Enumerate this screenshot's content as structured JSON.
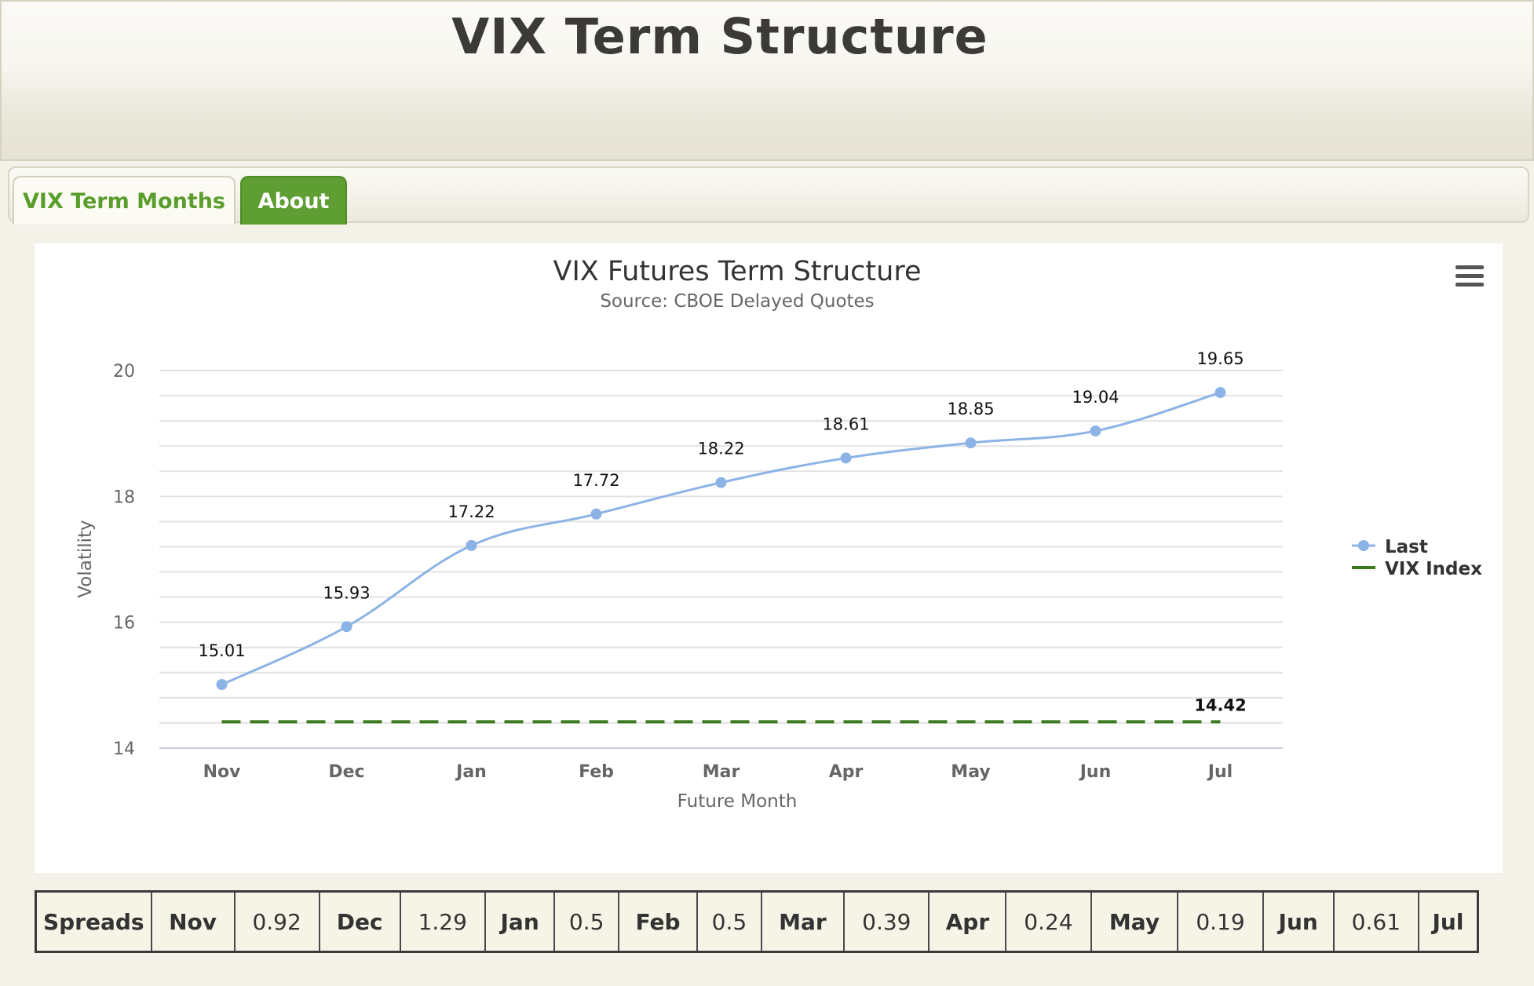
{
  "header": {
    "title": "VIX Term Structure"
  },
  "tabs": [
    {
      "label": "VIX Term Months"
    },
    {
      "label": "About"
    }
  ],
  "chart": {
    "menu_icon": "hamburger-menu-icon"
  },
  "chart_data": {
    "type": "line",
    "title": "VIX Futures Term Structure",
    "subtitle": "Source: CBOE Delayed Quotes",
    "xlabel": "Future Month",
    "ylabel": "Volatility",
    "categories": [
      "Nov",
      "Dec",
      "Jan",
      "Feb",
      "Mar",
      "Apr",
      "May",
      "Jun",
      "Jul"
    ],
    "ylim": [
      14,
      20
    ],
    "yticks": [
      "14",
      "16",
      "18",
      "20"
    ],
    "grid": true,
    "legend_position": "right",
    "series": [
      {
        "name": "Last",
        "values": [
          15.01,
          15.93,
          17.22,
          17.72,
          18.22,
          18.61,
          18.85,
          19.04,
          19.65
        ],
        "labels": [
          "15.01",
          "15.93",
          "17.22",
          "17.72",
          "18.22",
          "18.61",
          "18.85",
          "19.04",
          "19.65"
        ],
        "color": "#8cb3e6",
        "style": "smooth-line-markers"
      },
      {
        "name": "VIX Index",
        "values": [
          14.42,
          14.42,
          14.42,
          14.42,
          14.42,
          14.42,
          14.42,
          14.42,
          14.42
        ],
        "label": "14.42",
        "color": "#3b7a1f",
        "style": "dashed"
      }
    ]
  },
  "spreads": {
    "label": "Spreads",
    "cells": [
      {
        "month": "Nov",
        "value": "0.92"
      },
      {
        "month": "Dec",
        "value": "1.29"
      },
      {
        "month": "Jan",
        "value": "0.5"
      },
      {
        "month": "Feb",
        "value": "0.5"
      },
      {
        "month": "Mar",
        "value": "0.39"
      },
      {
        "month": "Apr",
        "value": "0.24"
      },
      {
        "month": "May",
        "value": "0.19"
      },
      {
        "month": "Jun",
        "value": "0.61"
      }
    ],
    "last_month": "Jul"
  }
}
